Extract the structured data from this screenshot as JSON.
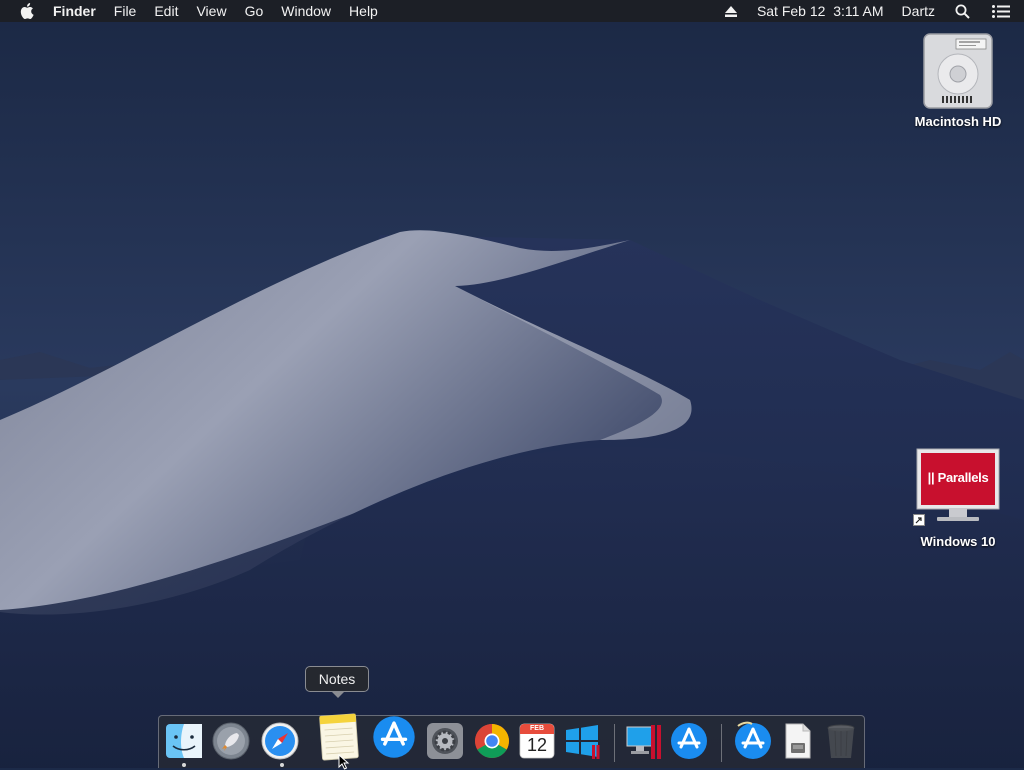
{
  "menubar": {
    "apple_icon": "apple-icon",
    "app_name": "Finder",
    "menus": [
      "File",
      "Edit",
      "View",
      "Go",
      "Window",
      "Help"
    ],
    "eject_icon": "eject-icon",
    "datetime": "Sat Feb 12  3:11 AM",
    "user": "Dartz",
    "search_icon": "spotlight-search-icon",
    "notification_icon": "notification-center-icon"
  },
  "desktop": {
    "icons": [
      {
        "label": "Macintosh HD",
        "icon": "hard-drive-icon"
      },
      {
        "label": "Windows 10",
        "icon": "parallels-vm-icon",
        "badge_text": "|| Parallels"
      }
    ]
  },
  "tooltip": {
    "text": "Notes"
  },
  "dock": {
    "items": [
      {
        "name": "Finder",
        "icon": "finder-icon",
        "running": true
      },
      {
        "name": "Launchpad",
        "icon": "launchpad-icon",
        "running": false
      },
      {
        "name": "Safari",
        "icon": "safari-icon",
        "running": true
      },
      {
        "name": "Notes",
        "icon": "notes-icon",
        "running": false
      },
      {
        "name": "App Store",
        "icon": "app-store-icon",
        "running": false
      },
      {
        "name": "System Preferences",
        "icon": "system-preferences-icon",
        "running": false
      },
      {
        "name": "Google Chrome",
        "icon": "chrome-icon",
        "running": false
      },
      {
        "name": "Calendar",
        "icon": "calendar-icon",
        "running": false,
        "month": "FEB",
        "day": "12"
      },
      {
        "name": "Windows 10",
        "icon": "windows-parallels-icon",
        "running": false
      },
      {
        "name": "Parallels Desktop",
        "icon": "parallels-desktop-icon",
        "running": false
      },
      {
        "name": "App Store",
        "icon": "app-store-icon",
        "running": false
      },
      {
        "name": "Downloads",
        "icon": "app-store-folder-icon",
        "running": false
      },
      {
        "name": "Document",
        "icon": "document-icon",
        "running": false
      },
      {
        "name": "Trash",
        "icon": "trash-icon",
        "running": false
      }
    ]
  },
  "colors": {
    "menubar_bg": "#1c1e24",
    "sky": "#1c2a48",
    "parallels_red": "#c8102e",
    "appstore_blue": "#1a8cf0"
  }
}
